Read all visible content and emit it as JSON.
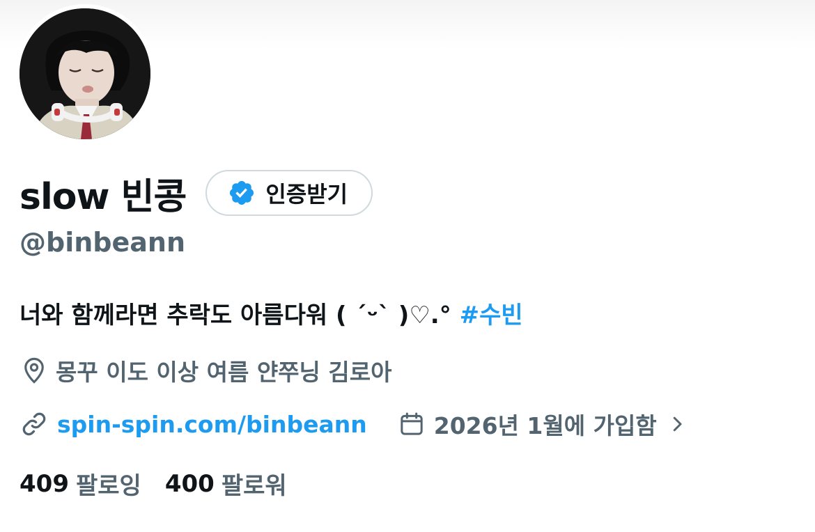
{
  "profile": {
    "display_name": "slow 빈콩",
    "handle": "@binbeann",
    "verify_button_label": "인증받기",
    "bio_text": "너와 함께라면 추락도 아름다워 ( ´ᵕ` )♡.°",
    "bio_hashtag": "#수빈",
    "location": "몽꾸 이도 이상 여름 얀쭈닝 김로아",
    "website": "spin-spin.com/binbeann",
    "joined": "2026년 1월에 가입함",
    "following_count": "409",
    "following_label": "팔로잉",
    "followers_count": "400",
    "followers_label": "팔로워"
  },
  "icons": {
    "verified": "verified-badge-icon",
    "location": "location-pin-icon",
    "link": "link-icon",
    "calendar": "calendar-icon",
    "chevron": "chevron-right-icon"
  },
  "colors": {
    "accent": "#1d9bf0",
    "secondary_text": "#536471",
    "primary_text": "#0f1419",
    "border": "#cfd9de"
  }
}
